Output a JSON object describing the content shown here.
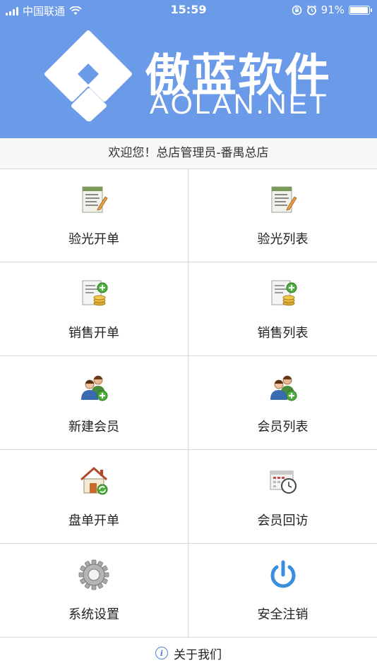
{
  "status_bar": {
    "carrier": "中国联通",
    "time": "15:59",
    "battery_pct": "91%",
    "battery_level": 0.91
  },
  "banner": {
    "brand_cn": "傲蓝软件",
    "brand_en": "AOLAN.NET",
    "color": "#6b9ae8"
  },
  "welcome": "欢迎您！总店管理员-番禺总店",
  "menu": [
    {
      "label": "验光开单",
      "icon": "document-edit-icon"
    },
    {
      "label": "验光列表",
      "icon": "document-edit-icon"
    },
    {
      "label": "销售开单",
      "icon": "invoice-coins-icon"
    },
    {
      "label": "销售列表",
      "icon": "invoice-coins-icon"
    },
    {
      "label": "新建会员",
      "icon": "users-add-icon"
    },
    {
      "label": "会员列表",
      "icon": "users-add-icon"
    },
    {
      "label": "盘单开单",
      "icon": "house-refresh-icon"
    },
    {
      "label": "会员回访",
      "icon": "calendar-clock-icon"
    },
    {
      "label": "系统设置",
      "icon": "gear-icon"
    },
    {
      "label": "安全注销",
      "icon": "power-icon"
    }
  ],
  "about_label": "关于我们"
}
